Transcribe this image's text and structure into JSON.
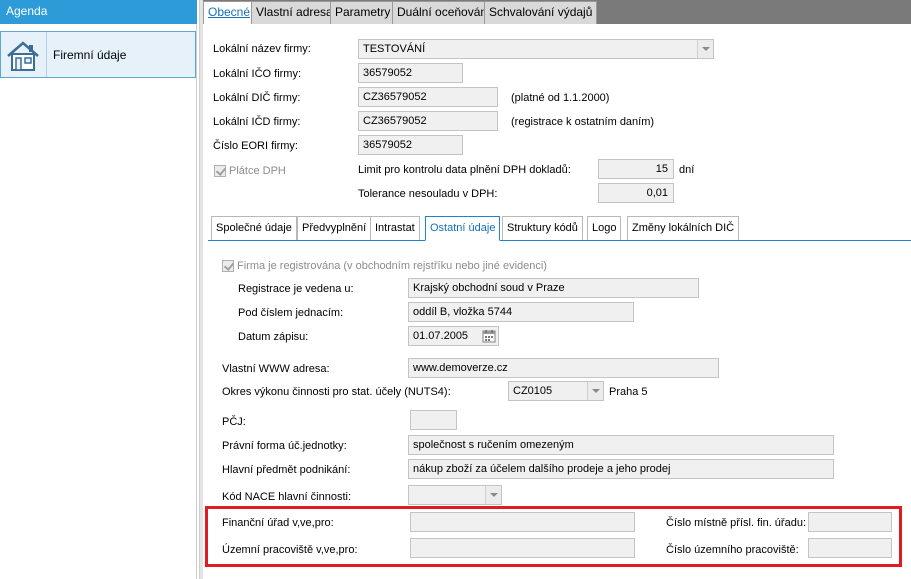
{
  "agenda": {
    "header": "Agenda",
    "item_label": "Firemní údaje",
    "item_icon": "company-house-icon"
  },
  "top_tabs": [
    {
      "label": "Obecné"
    },
    {
      "label": "Vlastní adresa"
    },
    {
      "label": "Parametry"
    },
    {
      "label": "Duální oceňování"
    },
    {
      "label": "Schvalování výdajů"
    }
  ],
  "general": {
    "name_label": "Lokální název firmy:",
    "name_value": "TESTOVÁNÍ",
    "ico_label": "Lokální IČO firmy:",
    "ico_value": "36579052",
    "dic_label": "Lokální DIČ firmy:",
    "dic_value": "CZ36579052",
    "dic_note": "(platné od 1.1.2000)",
    "icd_label": "Lokální IČD firmy:",
    "icd_value": "CZ36579052",
    "icd_note": "(registrace k ostatním daním)",
    "eori_label": "Číslo EORI firmy:",
    "eori_value": "36579052",
    "vat_payer_label": "Plátce DPH",
    "limit_label": "Limit pro kontrolu data plnění DPH dokladů:",
    "limit_value": "15",
    "limit_unit": "dní",
    "tolerance_label": "Tolerance nesouladu v DPH:",
    "tolerance_value": "0,01"
  },
  "inner_tabs": [
    {
      "label": "Společné údaje"
    },
    {
      "label": "Předvyplnění"
    },
    {
      "label": "Intrastat"
    },
    {
      "label": "Ostatní údaje"
    },
    {
      "label": "Struktury kódů"
    },
    {
      "label": "Logo"
    },
    {
      "label": "Změny lokálních DIČ"
    }
  ],
  "other": {
    "registered_label": "Firma je registrována (v obchodním rejstříku nebo jiné evidenci)",
    "reg_at_label": "Registrace je vedena u:",
    "reg_at_value": "Krajský obchodní soud v Praze",
    "reg_no_label": "Pod číslem jednacím:",
    "reg_no_value": "oddíl B, vložka 5744",
    "reg_date_label": "Datum zápisu:",
    "reg_date_value": "01.07.2005",
    "www_label": "Vlastní WWW adresa:",
    "www_value": "www.demoverze.cz",
    "nuts_label": "Okres výkonu činnosti pro stat. účely (NUTS4):",
    "nuts_value": "CZ0105",
    "nuts_name": "Praha 5",
    "pcj_label": "PČJ:",
    "pcj_value": "",
    "legal_form_label": "Právní forma úč.jednotky:",
    "legal_form_value": "společnost s ručením omezeným",
    "main_activity_label": "Hlavní předmět podnikání:",
    "main_activity_value": "nákup zboží za účelem dalšího prodeje a jeho prodej",
    "nace_label": "Kód NACE hlavní činnosti:",
    "nace_value": "",
    "tax_office_label": "Finanční úřad v,ve,pro:",
    "tax_office_value": "",
    "local_office_no_label": "Číslo místně přísl. fin. úřadu:",
    "local_office_no_value": "",
    "territorial_label": "Územní pracoviště v,ve,pro:",
    "territorial_value": "",
    "territorial_no_label": "Číslo územního pracoviště:",
    "territorial_no_value": ""
  },
  "colors": {
    "accent": "#2c9bd7",
    "highlight_border": "#e11b22"
  }
}
